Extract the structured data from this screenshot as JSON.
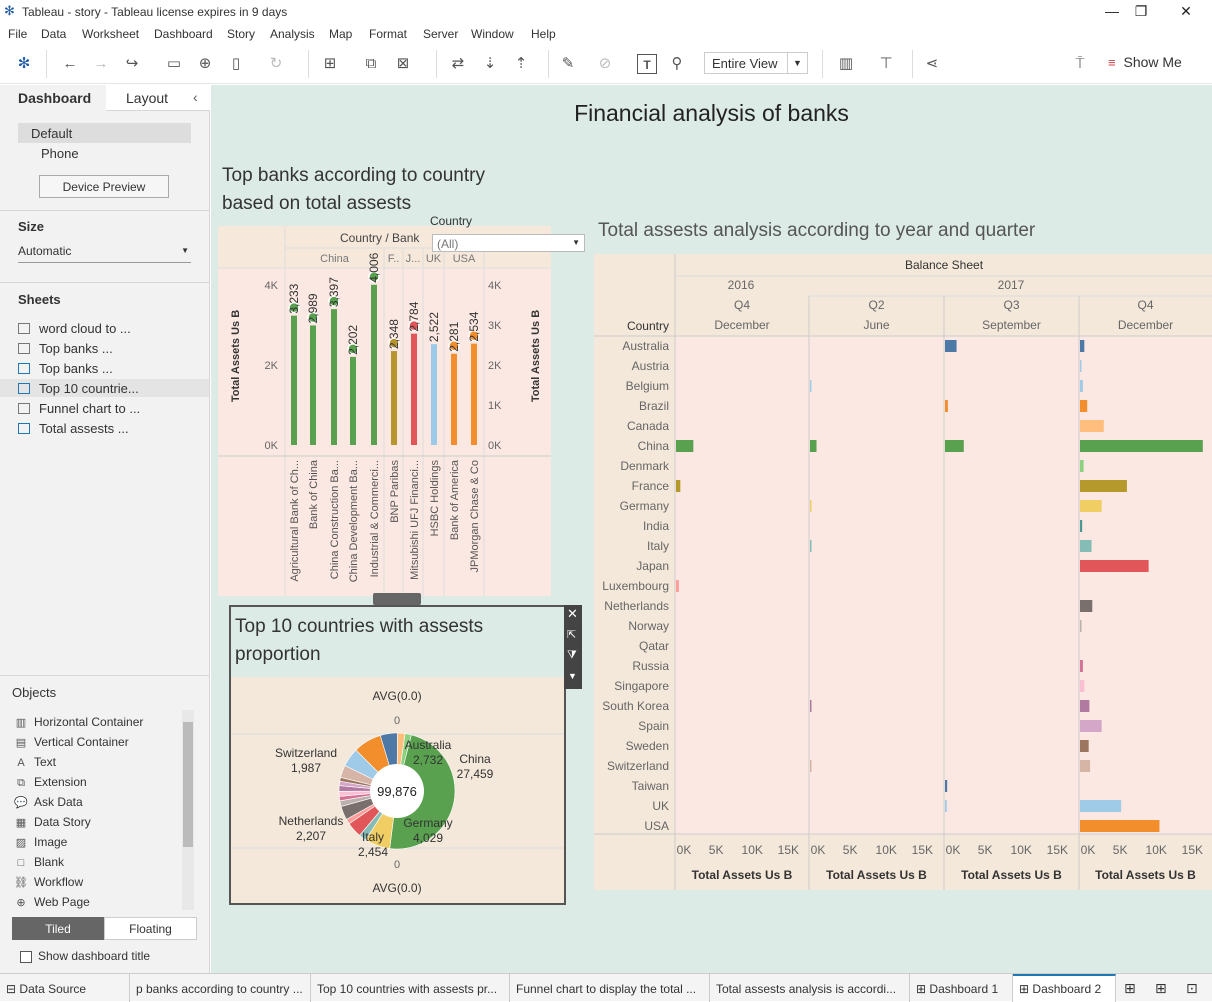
{
  "window": {
    "title": "Tableau - story - Tableau license expires in 9 days",
    "minimize": "—",
    "restore": "❐",
    "close": "✕"
  },
  "menu": [
    "File",
    "Data",
    "Worksheet",
    "Dashboard",
    "Story",
    "Analysis",
    "Map",
    "Format",
    "Server",
    "Window",
    "Help"
  ],
  "toolbar": {
    "view_select": "Entire View",
    "show_me": "Show Me"
  },
  "left_pane": {
    "tabs": [
      "Dashboard",
      "Layout"
    ],
    "devices": [
      "Default",
      "Phone"
    ],
    "device_preview": "Device Preview",
    "size_title": "Size",
    "size_value": "Automatic",
    "sheets_title": "Sheets",
    "sheets": [
      "word cloud to ...",
      "Top banks ...",
      "Top banks ...",
      "Top 10 countrie...",
      "Funnel chart to ...",
      "Total assests ..."
    ],
    "objects_title": "Objects",
    "objects": [
      {
        "label": "Horizontal Container",
        "icon": "▥"
      },
      {
        "label": "Vertical Container",
        "icon": "▤"
      },
      {
        "label": "Text",
        "icon": "A"
      },
      {
        "label": "Extension",
        "icon": "⧉"
      },
      {
        "label": "Ask Data",
        "icon": "💬"
      },
      {
        "label": "Data Story",
        "icon": "▦"
      },
      {
        "label": "Image",
        "icon": "▨"
      },
      {
        "label": "Blank",
        "icon": "□"
      },
      {
        "label": "Workflow",
        "icon": "⛓"
      },
      {
        "label": "Web Page",
        "icon": "⊕"
      }
    ],
    "layout_mode": [
      "Tiled",
      "Floating"
    ],
    "show_title": "Show dashboard title"
  },
  "dashboard": {
    "title": "Financial analysis of banks",
    "bank_chart_title": "Top banks according to country based on total assests",
    "country_filter_label": "Country",
    "country_filter_value": "(All)",
    "header_country_bank": "Country  /  Bank",
    "country_groups": [
      "China",
      "F..",
      "J...",
      "UK",
      "USA"
    ],
    "y_axis_label": "Total Assets Us B",
    "left_ticks": [
      "4K",
      "2K",
      "0K"
    ],
    "right_ticks": [
      "4K",
      "3K",
      "2K",
      "1K",
      "0K"
    ],
    "banks": [
      {
        "name": "Agricultural Bank of Ch...",
        "value": 3233,
        "label": "3,233",
        "color": "#59a14f",
        "dot": true
      },
      {
        "name": "Bank of China",
        "value": 2989,
        "label": "2,989",
        "color": "#59a14f",
        "dot": true
      },
      {
        "name": "China Construction Ba...",
        "value": 3397,
        "label": "3,397",
        "color": "#59a14f",
        "dot": true
      },
      {
        "name": "China Development Ba...",
        "value": 2202,
        "label": "2,202",
        "color": "#59a14f",
        "dot": true
      },
      {
        "name": "Industrial & Commerci...",
        "value": 4006,
        "label": "4,006",
        "color": "#59a14f",
        "dot": true
      },
      {
        "name": "BNP Paribas",
        "value": 2348,
        "label": "2,348",
        "color": "#b8962e",
        "dot": true
      },
      {
        "name": "Mitsubishi UFJ Financi...",
        "value": 2784,
        "label": "2,784",
        "color": "#e15759",
        "dot": true
      },
      {
        "name": "HSBC Holdings",
        "value": 2522,
        "label": "2,522",
        "color": "#9ecae9",
        "dot": false
      },
      {
        "name": "Bank of America",
        "value": 2281,
        "label": "2,281",
        "color": "#f28e2b",
        "dot": true
      },
      {
        "name": "JPMorgan Chase & Co",
        "value": 2534,
        "label": "2,534",
        "color": "#f28e2b",
        "dot": true
      }
    ],
    "pie_title": "Top 10 countries with assests proportion",
    "pie_top_label": "AVG(0.0)",
    "pie_top_zero": "0",
    "pie_bottom_zero": "0",
    "pie_bottom_label": "AVG(0.0)",
    "pie_total": "99,876",
    "pie_labels": [
      {
        "name": "Switzerland",
        "value": "1,987"
      },
      {
        "name": "Australia",
        "value": "2,732"
      },
      {
        "name": "China",
        "value": "27,459"
      },
      {
        "name": "Netherlands",
        "value": "2,207"
      },
      {
        "name": "Italy",
        "value": "2,454"
      },
      {
        "name": "Germany",
        "value": "4,029"
      }
    ],
    "assets_title": "Total assests analysis according to year and quarter",
    "balance_sheet": "Balance Sheet",
    "years": [
      "2016",
      "2017"
    ],
    "quarters": [
      "Q4",
      "Q2",
      "Q3",
      "Q4"
    ],
    "months": [
      "December",
      "June",
      "September",
      "December"
    ],
    "country_header": "Country",
    "x_ticks": [
      "0K",
      "5K",
      "10K",
      "15K"
    ],
    "x_axis_label": "Total Assets Us B",
    "countries": [
      "Australia",
      "Austria",
      "Belgium",
      "Brazil",
      "Canada",
      "China",
      "Denmark",
      "France",
      "Germany",
      "India",
      "Italy",
      "Japan",
      "Luxembourg",
      "Netherlands",
      "Norway",
      "Qatar",
      "Russia",
      "Singapore",
      "South Korea",
      "Spain",
      "Sweden",
      "Switzerland",
      "Taiwan",
      "UK",
      "USA"
    ]
  },
  "chart_data": {
    "type": "bar",
    "title": "Total assests analysis according to year and quarter",
    "xlabel": "Total Assets Us B",
    "ylabel": "Country",
    "xlim": [
      0,
      18000
    ],
    "categories": [
      "Australia",
      "Austria",
      "Belgium",
      "Brazil",
      "Canada",
      "China",
      "Denmark",
      "France",
      "Germany",
      "India",
      "Italy",
      "Japan",
      "Luxembourg",
      "Netherlands",
      "Norway",
      "Qatar",
      "Russia",
      "Singapore",
      "South Korea",
      "Spain",
      "Sweden",
      "Switzerland",
      "Taiwan",
      "UK",
      "USA"
    ],
    "colors": [
      "#4e79a7",
      "#a0cbe8",
      "#a0cbe8",
      "#f28e2b",
      "#ffbe7d",
      "#59a14f",
      "#8cd17d",
      "#b6992d",
      "#f1ce63",
      "#499894",
      "#86bcb6",
      "#e15759",
      "#ff9d9a",
      "#79706e",
      "#bab0ac",
      "#d37295",
      "#d37295",
      "#fabfd2",
      "#b07aa1",
      "#d4a6c8",
      "#9d7660",
      "#d7b5a6",
      "#4e79a7",
      "#a0cbe8",
      "#f28e2b"
    ],
    "series": [
      {
        "name": "2016 Q4 December",
        "values": [
          0,
          0,
          0,
          0,
          0,
          2400,
          0,
          600,
          0,
          0,
          0,
          0,
          400,
          0,
          0,
          0,
          0,
          0,
          0,
          0,
          0,
          0,
          0,
          0,
          0
        ]
      },
      {
        "name": "2017 Q2 June",
        "values": [
          0,
          0,
          150,
          0,
          0,
          900,
          0,
          0,
          150,
          0,
          150,
          0,
          0,
          0,
          0,
          0,
          0,
          0,
          150,
          0,
          0,
          150,
          0,
          0,
          0
        ]
      },
      {
        "name": "2017 Q3 September",
        "values": [
          1600,
          0,
          0,
          400,
          0,
          2600,
          0,
          0,
          0,
          0,
          0,
          0,
          0,
          0,
          0,
          0,
          0,
          0,
          0,
          0,
          0,
          0,
          300,
          250,
          0
        ]
      },
      {
        "name": "2017 Q4 December",
        "values": [
          600,
          150,
          400,
          1000,
          3300,
          17000,
          500,
          6500,
          3000,
          300,
          1600,
          9500,
          0,
          1700,
          150,
          0,
          400,
          600,
          1300,
          3000,
          1200,
          1400,
          0,
          5700,
          11000
        ]
      }
    ]
  }
}
